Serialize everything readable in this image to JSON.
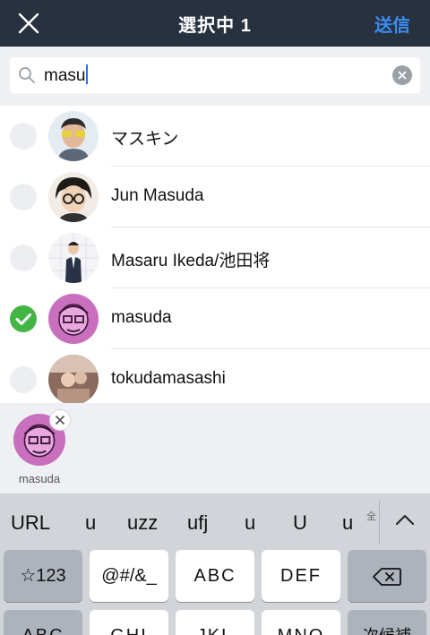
{
  "header": {
    "close_icon": "close-icon",
    "title": "選択中 1",
    "send_label": "送信",
    "colors": {
      "background": "#27313f",
      "send": "#3b8cf0"
    }
  },
  "search": {
    "icon": "search-icon",
    "value": "masu",
    "clear_icon": "clear-circle-icon"
  },
  "contacts": [
    {
      "name": "マスキン",
      "selected": false
    },
    {
      "name": "Jun Masuda",
      "selected": false
    },
    {
      "name": "Masaru Ikeda/池田将",
      "selected": false
    },
    {
      "name": "masuda",
      "selected": true
    },
    {
      "name": "tokudamasashi",
      "selected": false
    }
  ],
  "selected_tray": {
    "items": [
      {
        "name": "masuda"
      }
    ],
    "remove_icon": "close-icon"
  },
  "keyboard": {
    "candidates": [
      "URL",
      "u",
      "uzz",
      "ufj",
      "u",
      "U",
      "u"
    ],
    "full_width_label": "全",
    "expand_icon": "chevron-up-icon",
    "row1": [
      "☆123",
      "@#/&_",
      "ABC",
      "DEF"
    ],
    "delete_icon": "backspace-icon",
    "row2_partial": [
      "ABC",
      "GHI",
      "JKL",
      "MNO",
      "次候補"
    ]
  },
  "colors": {
    "check": "#43b545",
    "accent": "#2f6fe0"
  }
}
